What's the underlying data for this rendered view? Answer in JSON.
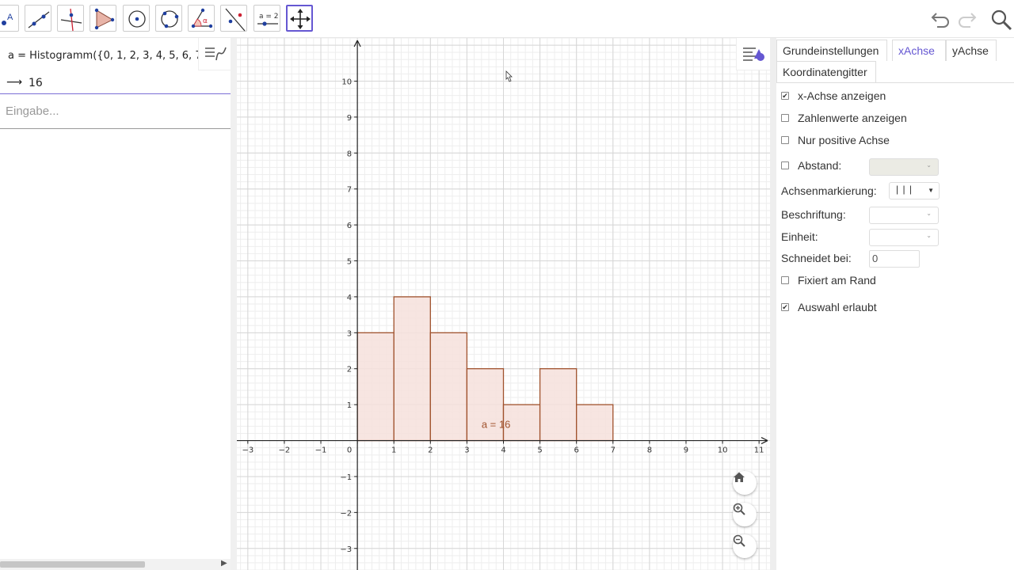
{
  "toolbar": {
    "tools": [
      {
        "name": "point-tool",
        "icon": "point-icon",
        "label_glyph": "A"
      },
      {
        "name": "line-tool",
        "icon": "line-icon"
      },
      {
        "name": "perpendicular-line-tool",
        "icon": "perpendicular-line-icon"
      },
      {
        "name": "polygon-tool",
        "icon": "polygon-icon"
      },
      {
        "name": "circle-center-point-tool",
        "icon": "circle-center-icon"
      },
      {
        "name": "circle-three-points-tool",
        "icon": "circle-three-points-icon"
      },
      {
        "name": "angle-tool",
        "icon": "angle-icon",
        "label_glyph": "α"
      },
      {
        "name": "reflect-tool",
        "icon": "reflect-icon"
      },
      {
        "name": "slider-tool",
        "icon": "slider-icon",
        "label_glyph": "a = 2"
      },
      {
        "name": "move-graphics-tool",
        "icon": "move-arrows-icon",
        "active": true
      }
    ],
    "right": [
      "undo-icon",
      "redo-icon",
      "search-icon"
    ]
  },
  "algebra": {
    "definition": "a  =  Histogramm({0, 1, 2, 3, 4, 5, 6, 7",
    "result_arrow": "⟶",
    "result": "16",
    "input_placeholder": "Eingabe..."
  },
  "graphics": {
    "object_label": "a = 16",
    "object_color": "#a0522d",
    "fill_color": "#f6e1dc"
  },
  "chart_data": {
    "type": "bar",
    "title": "",
    "xlabel": "",
    "ylabel": "",
    "x_ticks": [
      "−3",
      "−2",
      "−1",
      "0",
      "1",
      "2",
      "3",
      "4",
      "5",
      "6",
      "7",
      "8",
      "9",
      "10",
      "11"
    ],
    "y_ticks": [
      "−3",
      "−2",
      "−1",
      "1",
      "2",
      "3",
      "4",
      "5",
      "6",
      "7",
      "8",
      "9",
      "10"
    ],
    "bin_edges": [
      0,
      1,
      2,
      3,
      4,
      5,
      6,
      7
    ],
    "values": [
      3,
      4,
      3,
      2,
      1,
      2,
      1
    ],
    "xlim": [
      -3.3,
      11.3
    ],
    "ylim": [
      -3.6,
      11.2
    ],
    "grid": true
  },
  "properties": {
    "tabs": [
      {
        "label": "Grundeinstellungen",
        "active": false
      },
      {
        "label": "xAchse",
        "active": true
      },
      {
        "label": "yAchse",
        "active": false
      },
      {
        "label": "Koordinatengitter",
        "active": false
      }
    ],
    "show_axis": {
      "label": "x-Achse anzeigen",
      "checked": true
    },
    "show_numbers": {
      "label": "Zahlenwerte anzeigen",
      "checked": false
    },
    "positive_only": {
      "label": "Nur positive Achse",
      "checked": false
    },
    "distance": {
      "label": "Abstand:",
      "checked": false
    },
    "tick_style": {
      "label": "Achsenmarkierung:",
      "value": "| | |"
    },
    "axis_label": {
      "label": "Beschriftung:"
    },
    "unit": {
      "label": "Einheit:"
    },
    "cross_at": {
      "label": "Schneidet bei:",
      "value": "0"
    },
    "fixed_at_edge": {
      "label": "Fixiert am Rand",
      "checked": false
    },
    "selection_allowed": {
      "label": "Auswahl erlaubt",
      "checked": true
    },
    "accent_color": "#6557d2"
  }
}
